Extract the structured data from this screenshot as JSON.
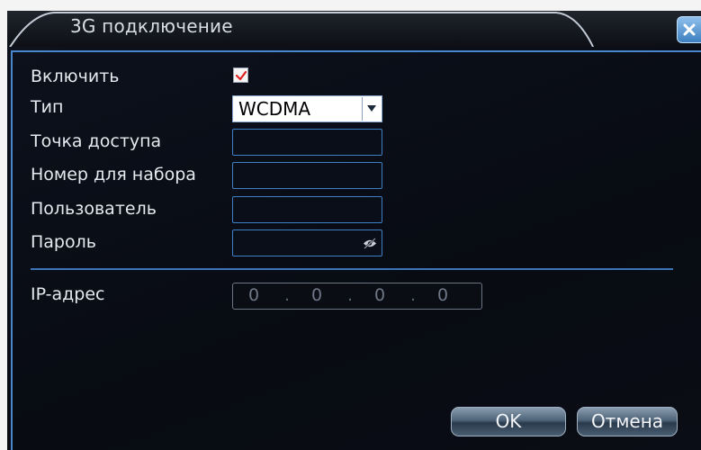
{
  "dialog": {
    "title": "3G подключение"
  },
  "form": {
    "enable_label": "Включить",
    "enable_checked": true,
    "type_label": "Тип",
    "type_value": "WCDMA",
    "apn_label": "Точка доступа",
    "apn_value": "",
    "dial_label": "Номер для набора",
    "dial_value": "",
    "user_label": "Пользователь",
    "user_value": "",
    "password_label": "Пароль",
    "password_value": "",
    "ip_label": "IP-адрес",
    "ip": [
      "0",
      "0",
      "0",
      "0"
    ]
  },
  "buttons": {
    "ok": "OK",
    "cancel": "Отмена"
  },
  "colors": {
    "accent": "#4a86cc",
    "checkmark": "#e02020",
    "panel_bg": "#0a0d15"
  },
  "icons": {
    "close": "close-icon",
    "check": "checkmark-icon",
    "dropdown": "chevron-down-icon",
    "password_visibility": "eye-hidden-icon"
  }
}
